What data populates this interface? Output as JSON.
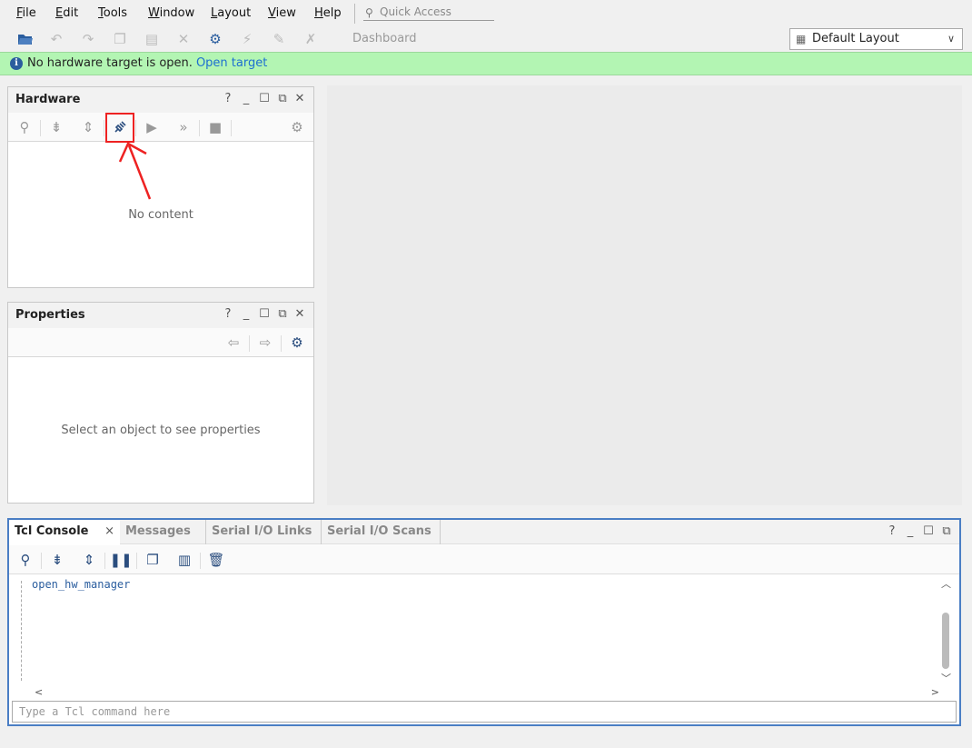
{
  "menu": {
    "items": [
      {
        "key": "F",
        "rest": "ile"
      },
      {
        "key": "E",
        "rest": "dit"
      },
      {
        "key": "T",
        "rest": "ools"
      },
      {
        "key": "W",
        "rest": "indow"
      },
      {
        "key": "L",
        "rest": "ayout"
      },
      {
        "key": "V",
        "rest": "iew"
      },
      {
        "key": "H",
        "rest": "elp"
      }
    ],
    "quick_access_placeholder": "Quick Access"
  },
  "toolbar": {
    "dashboard_label": "Dashboard",
    "layout_value": "Default Layout"
  },
  "banner": {
    "message": "No hardware target is open.",
    "link": "Open target",
    "color": "#b3f5b3"
  },
  "hardware_panel": {
    "title": "Hardware",
    "empty_message": "No content",
    "help": "?"
  },
  "properties_panel": {
    "title": "Properties",
    "empty_message": "Select an object to see properties",
    "help": "?"
  },
  "tcl_console": {
    "tabs": [
      "Tcl Console",
      "Messages",
      "Serial I/O Links",
      "Serial I/O Scans"
    ],
    "close_symbol": "×",
    "help": "?",
    "output_line": "open_hw_manager",
    "input_placeholder": "Type a Tcl command here"
  },
  "colors": {
    "accent": "#2a5d9e",
    "highlight": "#ee2222",
    "console_border": "#4a7ec4"
  }
}
